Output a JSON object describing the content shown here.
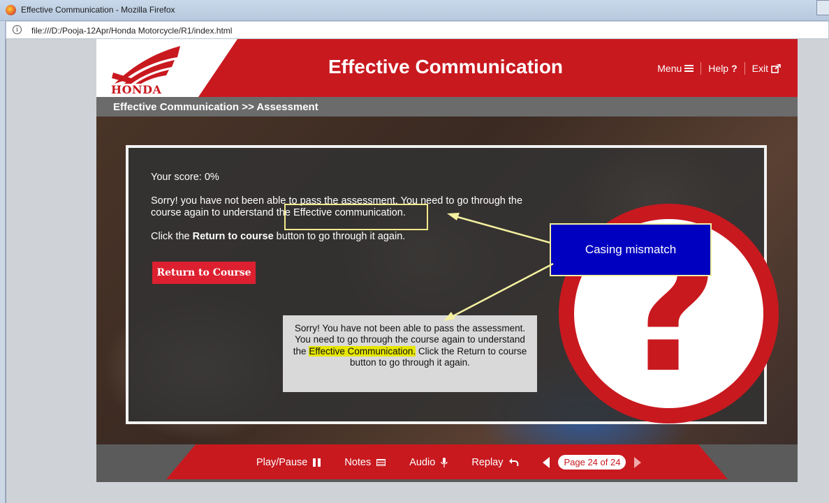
{
  "browser": {
    "window_title": "Effective Communication - Mozilla Firefox",
    "url": "file:///D:/Pooja-12Apr/Honda Motorcycle/R1/index.html"
  },
  "header": {
    "brand": "HONDA",
    "course_title": "Effective Communication",
    "nav": {
      "menu_label": "Menu",
      "help_label": "Help",
      "exit_label": "Exit"
    }
  },
  "breadcrumb": "Effective Communication >> Assessment",
  "result": {
    "score": "Your score: 0%",
    "message": "Sorry! you have not been able to pass the assessment. You need to go through the course again to understand the Effective communication.",
    "instruction_before": "Click the ",
    "instruction_bold": "Return to course",
    "instruction_after": " button to go through it again.",
    "return_button": "Return to Course"
  },
  "annotations": {
    "callout": "Casing mismatch",
    "note_part1": "Sorry! You have not been able to pass the assessment. You need to go through the course again to understand the ",
    "note_highlight": "Effective Communication.",
    "note_part2": " Click the Return to course button to go through it again.",
    "colors": {
      "callout_bg": "#0000c0",
      "highlight": "#e6e600",
      "arrow": "#f4f0a0"
    }
  },
  "footer": {
    "play_pause": "Play/Pause",
    "notes": "Notes",
    "audio": "Audio",
    "replay": "Replay",
    "page_indicator": "Page 24 of 24"
  },
  "colors": {
    "brand_red": "#c8191f",
    "button_red": "#dd2030"
  },
  "icons": [
    "firefox-icon",
    "info-icon",
    "hamburger-icon",
    "question-icon",
    "external-link-icon",
    "pause-icon",
    "notes-icon",
    "microphone-icon",
    "replay-icon",
    "prev-arrow-icon",
    "next-arrow-icon",
    "question-mark-graphic"
  ]
}
